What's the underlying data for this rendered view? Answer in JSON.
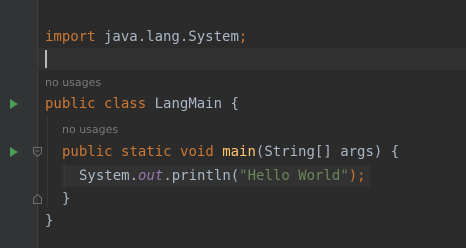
{
  "editor": {
    "import_keyword": "import",
    "import_path": " java.lang.System",
    "import_semicolon": ";",
    "hint_class_usages": "no usages",
    "class_public": "public",
    "class_keyword": "class",
    "class_name": "LangMain",
    "class_open_brace": " {",
    "hint_method_usages": "no usages",
    "method_public": "public",
    "method_static": "static",
    "method_void": "void",
    "method_name": "main",
    "method_params": "(String[] args) {",
    "call_object": "System.",
    "call_field": "out",
    "call_method": ".println(",
    "call_string": "\"Hello World\"",
    "call_end": ");",
    "method_close_brace": "}",
    "class_close_brace": "}"
  },
  "icons": {
    "run_class": "run-icon",
    "run_method": "run-icon",
    "fold_method_start": "fold-icon",
    "fold_method_end": "fold-icon"
  },
  "colors": {
    "background": "#2b2b2b",
    "keyword": "#cc7832",
    "function": "#ffc66d",
    "string": "#6a8759",
    "field": "#9876aa",
    "text": "#a9b7c6",
    "run_green": "#499c54"
  }
}
